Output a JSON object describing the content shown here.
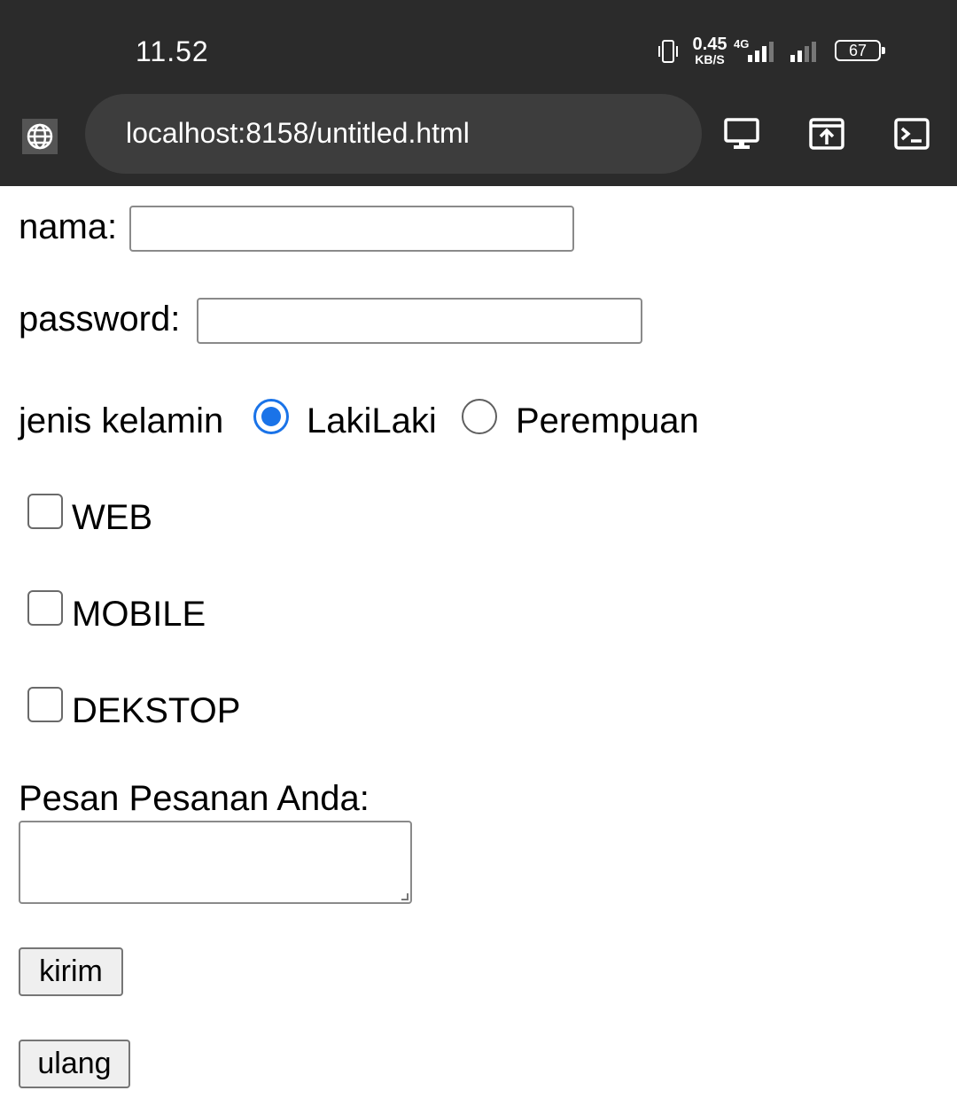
{
  "status_bar": {
    "time": "11.52",
    "net_speed_value": "0.45",
    "net_speed_unit": "KB/S",
    "network_type": "4G",
    "battery": "67"
  },
  "browser": {
    "url": "localhost:8158/untitled.html"
  },
  "form": {
    "nama_label": "nama:",
    "nama_value": "",
    "password_label": "password:",
    "password_value": "",
    "gender_label": "jenis kelamin",
    "gender_options": [
      "LakiLaki",
      "Perempuan"
    ],
    "gender_selected": "LakiLaki",
    "checkboxes": [
      "WEB",
      "MOBILE",
      "DEKSTOP"
    ],
    "message_label": "Pesan Pesanan Anda:",
    "message_value": "",
    "submit_label": "kirim",
    "reset_label": "ulang"
  },
  "colors": {
    "chrome_bg": "#2b2b2b",
    "url_pill": "#3d3d3d",
    "radio_accent": "#1a73e8"
  },
  "icons": {
    "status": [
      "vibrate-icon",
      "signal-icon",
      "battery-icon"
    ],
    "toolbar": [
      "globe-icon",
      "desktop-icon",
      "share-icon",
      "terminal-icon"
    ]
  }
}
